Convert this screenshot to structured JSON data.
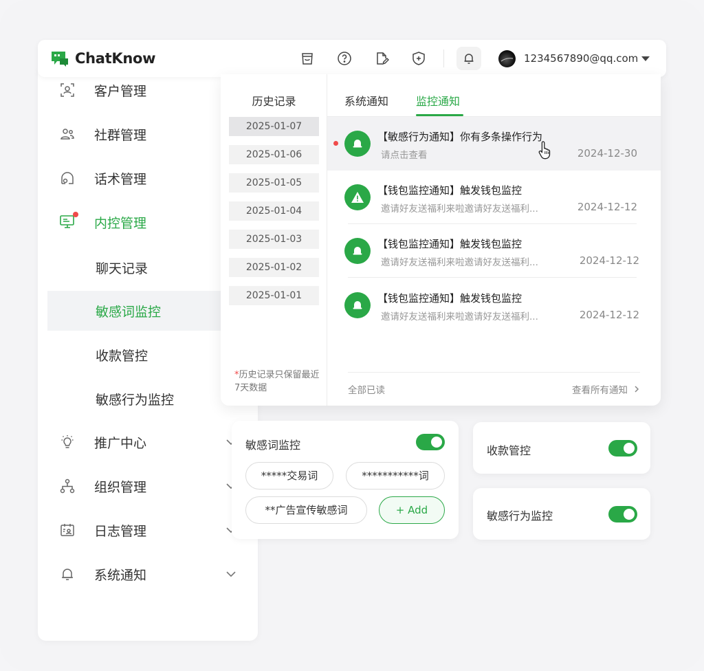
{
  "app": {
    "name": "ChatKnow"
  },
  "colors": {
    "accent": "#2aa847",
    "badge": "#f04a4a"
  },
  "header": {
    "icons": [
      "shop-icon",
      "help-icon",
      "edit-doc-icon",
      "shield-icon",
      "bell-icon"
    ],
    "user_email": "1234567890@qq.com"
  },
  "sidebar": {
    "items": [
      {
        "label": "客户管理",
        "icon": "customer-icon"
      },
      {
        "label": "社群管理",
        "icon": "group-icon"
      },
      {
        "label": "话术管理",
        "icon": "script-icon"
      },
      {
        "label": "内控管理",
        "icon": "monitor-icon",
        "active": true
      },
      {
        "label": "推广中心",
        "icon": "bulb-icon"
      },
      {
        "label": "组织管理",
        "icon": "org-icon"
      },
      {
        "label": "日志管理",
        "icon": "log-icon"
      },
      {
        "label": "系统通知",
        "icon": "bell-icon"
      }
    ],
    "subitems": [
      {
        "label": "聊天记录"
      },
      {
        "label": "敏感词监控",
        "active": true
      },
      {
        "label": "收款管控"
      },
      {
        "label": "敏感行为监控"
      }
    ]
  },
  "history": {
    "title": "历史记录",
    "dates": [
      "2025-01-07",
      "2025-01-06",
      "2025-01-05",
      "2025-01-04",
      "2025-01-03",
      "2025-01-02",
      "2025-01-01"
    ],
    "note_mark": "*",
    "note": "历史记录只保留最近7天数据"
  },
  "notifications": {
    "tabs": [
      "系统通知",
      "监控通知"
    ],
    "active_tab": 1,
    "items": [
      {
        "title": "【敏感行为通知】你有多条操作行为",
        "desc": "请点击查看",
        "date": "2024-12-30",
        "icon": "bell-icon",
        "unread": true
      },
      {
        "title": "【钱包监控通知】触发钱包监控",
        "desc": "邀请好友送福利来啦邀请好友送福利...",
        "date": "2024-12-12",
        "icon": "warning-icon"
      },
      {
        "title": "【钱包监控通知】触发钱包监控",
        "desc": "邀请好友送福利来啦邀请好友送福利...",
        "date": "2024-12-12",
        "icon": "bell-icon"
      },
      {
        "title": "【钱包监控通知】触发钱包监控",
        "desc": "邀请好友送福利来啦邀请好友送福利...",
        "date": "2024-12-12",
        "icon": "bell-icon"
      }
    ],
    "mark_all_read": "全部已读",
    "view_all": "查看所有通知"
  },
  "sensitive_card": {
    "title": "敏感词监控",
    "enabled": true,
    "chips": [
      "*****交易词",
      "***********词",
      "**广告宣传敏感词"
    ],
    "add_label": "+ Add"
  },
  "payment_card": {
    "title": "收款管控",
    "enabled": true
  },
  "behavior_card": {
    "title": "敏感行为监控",
    "enabled": true
  }
}
